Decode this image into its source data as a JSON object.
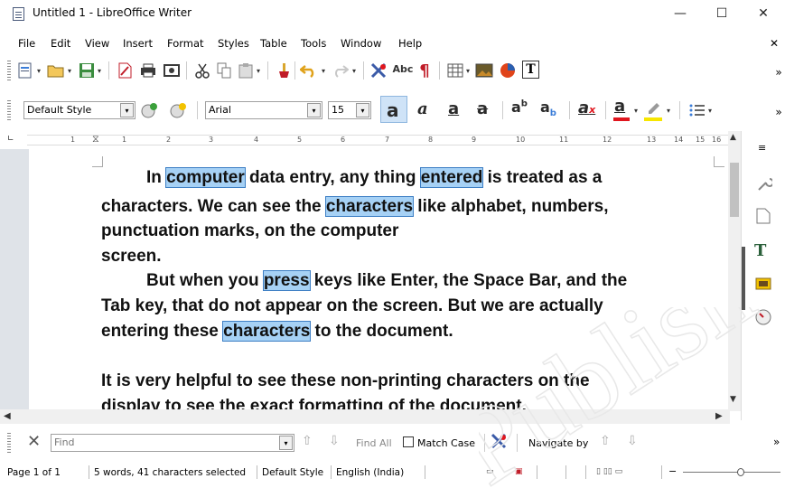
{
  "window": {
    "title": "Untitled 1 - LibreOffice Writer",
    "minimize": "—",
    "maximize": "☐",
    "close": "✕",
    "doc_close": "✕"
  },
  "menu": [
    "File",
    "Edit",
    "View",
    "Insert",
    "Format",
    "Styles",
    "Table",
    "Tools",
    "Window",
    "Help"
  ],
  "formatting": {
    "paragraph_style": "Default Style",
    "font_name": "Arial",
    "font_size": "15"
  },
  "ruler": {
    "ticks": [
      "1",
      "1",
      "2",
      "3",
      "4",
      "5",
      "6",
      "7",
      "8",
      "9",
      "10",
      "11",
      "12",
      "13",
      "14",
      "15",
      "16",
      "17"
    ]
  },
  "document": {
    "lines": [
      {
        "indent": true,
        "parts": [
          {
            "t": "In "
          },
          {
            "t": "computer",
            "hl": true
          },
          {
            "t": " data entry, any thing "
          },
          {
            "t": "entered",
            "hl": true
          },
          {
            "t": " is treated as a"
          }
        ]
      },
      {
        "indent": false,
        "parts": [
          {
            "t": "characters. We can see the "
          },
          {
            "t": "characters",
            "hl": true
          },
          {
            "t": " like alphabet, numbers,"
          }
        ]
      },
      {
        "indent": false,
        "parts": [
          {
            "t": "punctuation marks, on the computer"
          }
        ]
      },
      {
        "indent": false,
        "parts": [
          {
            "t": "screen."
          }
        ]
      },
      {
        "indent": true,
        "parts": [
          {
            "t": "But when you "
          },
          {
            "t": "press",
            "hl": true
          },
          {
            "t": " keys like Enter, the Space Bar, and the"
          }
        ]
      },
      {
        "indent": false,
        "parts": [
          {
            "t": "Tab key, that do not appear on the screen. But we are actually"
          }
        ]
      },
      {
        "indent": false,
        "parts": [
          {
            "t": "entering these "
          },
          {
            "t": "characters",
            "hl": true
          },
          {
            "t": " to the document."
          }
        ]
      },
      {
        "indent": false,
        "parts": [
          {
            "t": ""
          }
        ]
      },
      {
        "indent": false,
        "parts": [
          {
            "t": "It is very helpful to see these non-printing characters on the"
          }
        ]
      },
      {
        "indent": false,
        "parts": [
          {
            "t": "display to see the exact formatting of the document."
          }
        ]
      }
    ]
  },
  "find_toolbar": {
    "placeholder": "Find",
    "find_all": "Find All",
    "match_case": "Match Case",
    "navigate_by": "Navigate by"
  },
  "status": {
    "page": "Page 1 of 1",
    "selection": "5 words, 41 characters selected",
    "page_style": "Default Style",
    "language": "English (India)"
  },
  "watermark": "Published",
  "colors": {
    "highlight": "#a6d1f5",
    "highlight_border": "#3e7fc4",
    "font_color_bar": "#e0161e",
    "highlight_color_bar": "#f7e600"
  }
}
